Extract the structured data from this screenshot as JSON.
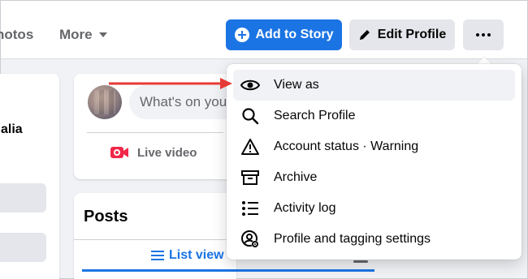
{
  "nav": {
    "photos_tab": "hotos",
    "more_tab": "More"
  },
  "header_actions": {
    "add_to_story": "Add to Story",
    "edit_profile": "Edit Profile"
  },
  "left_sidebar": {
    "text": "alia"
  },
  "composer": {
    "placeholder": "What's on you",
    "live_video": "Live video"
  },
  "posts": {
    "title": "Posts",
    "list_view": "List view"
  },
  "dropdown_menu": {
    "items": [
      {
        "label": "View as",
        "icon": "eye-icon"
      },
      {
        "label": "Search Profile",
        "icon": "search-icon"
      },
      {
        "label": "Account status · Warning",
        "icon": "warning-icon"
      },
      {
        "label": "Archive",
        "icon": "archive-icon"
      },
      {
        "label": "Activity log",
        "icon": "list-icon"
      },
      {
        "label": "Profile and tagging settings",
        "icon": "profile-settings-icon"
      }
    ]
  },
  "colors": {
    "brand_blue": "#1b74e4",
    "annotation_red": "#e53935"
  }
}
